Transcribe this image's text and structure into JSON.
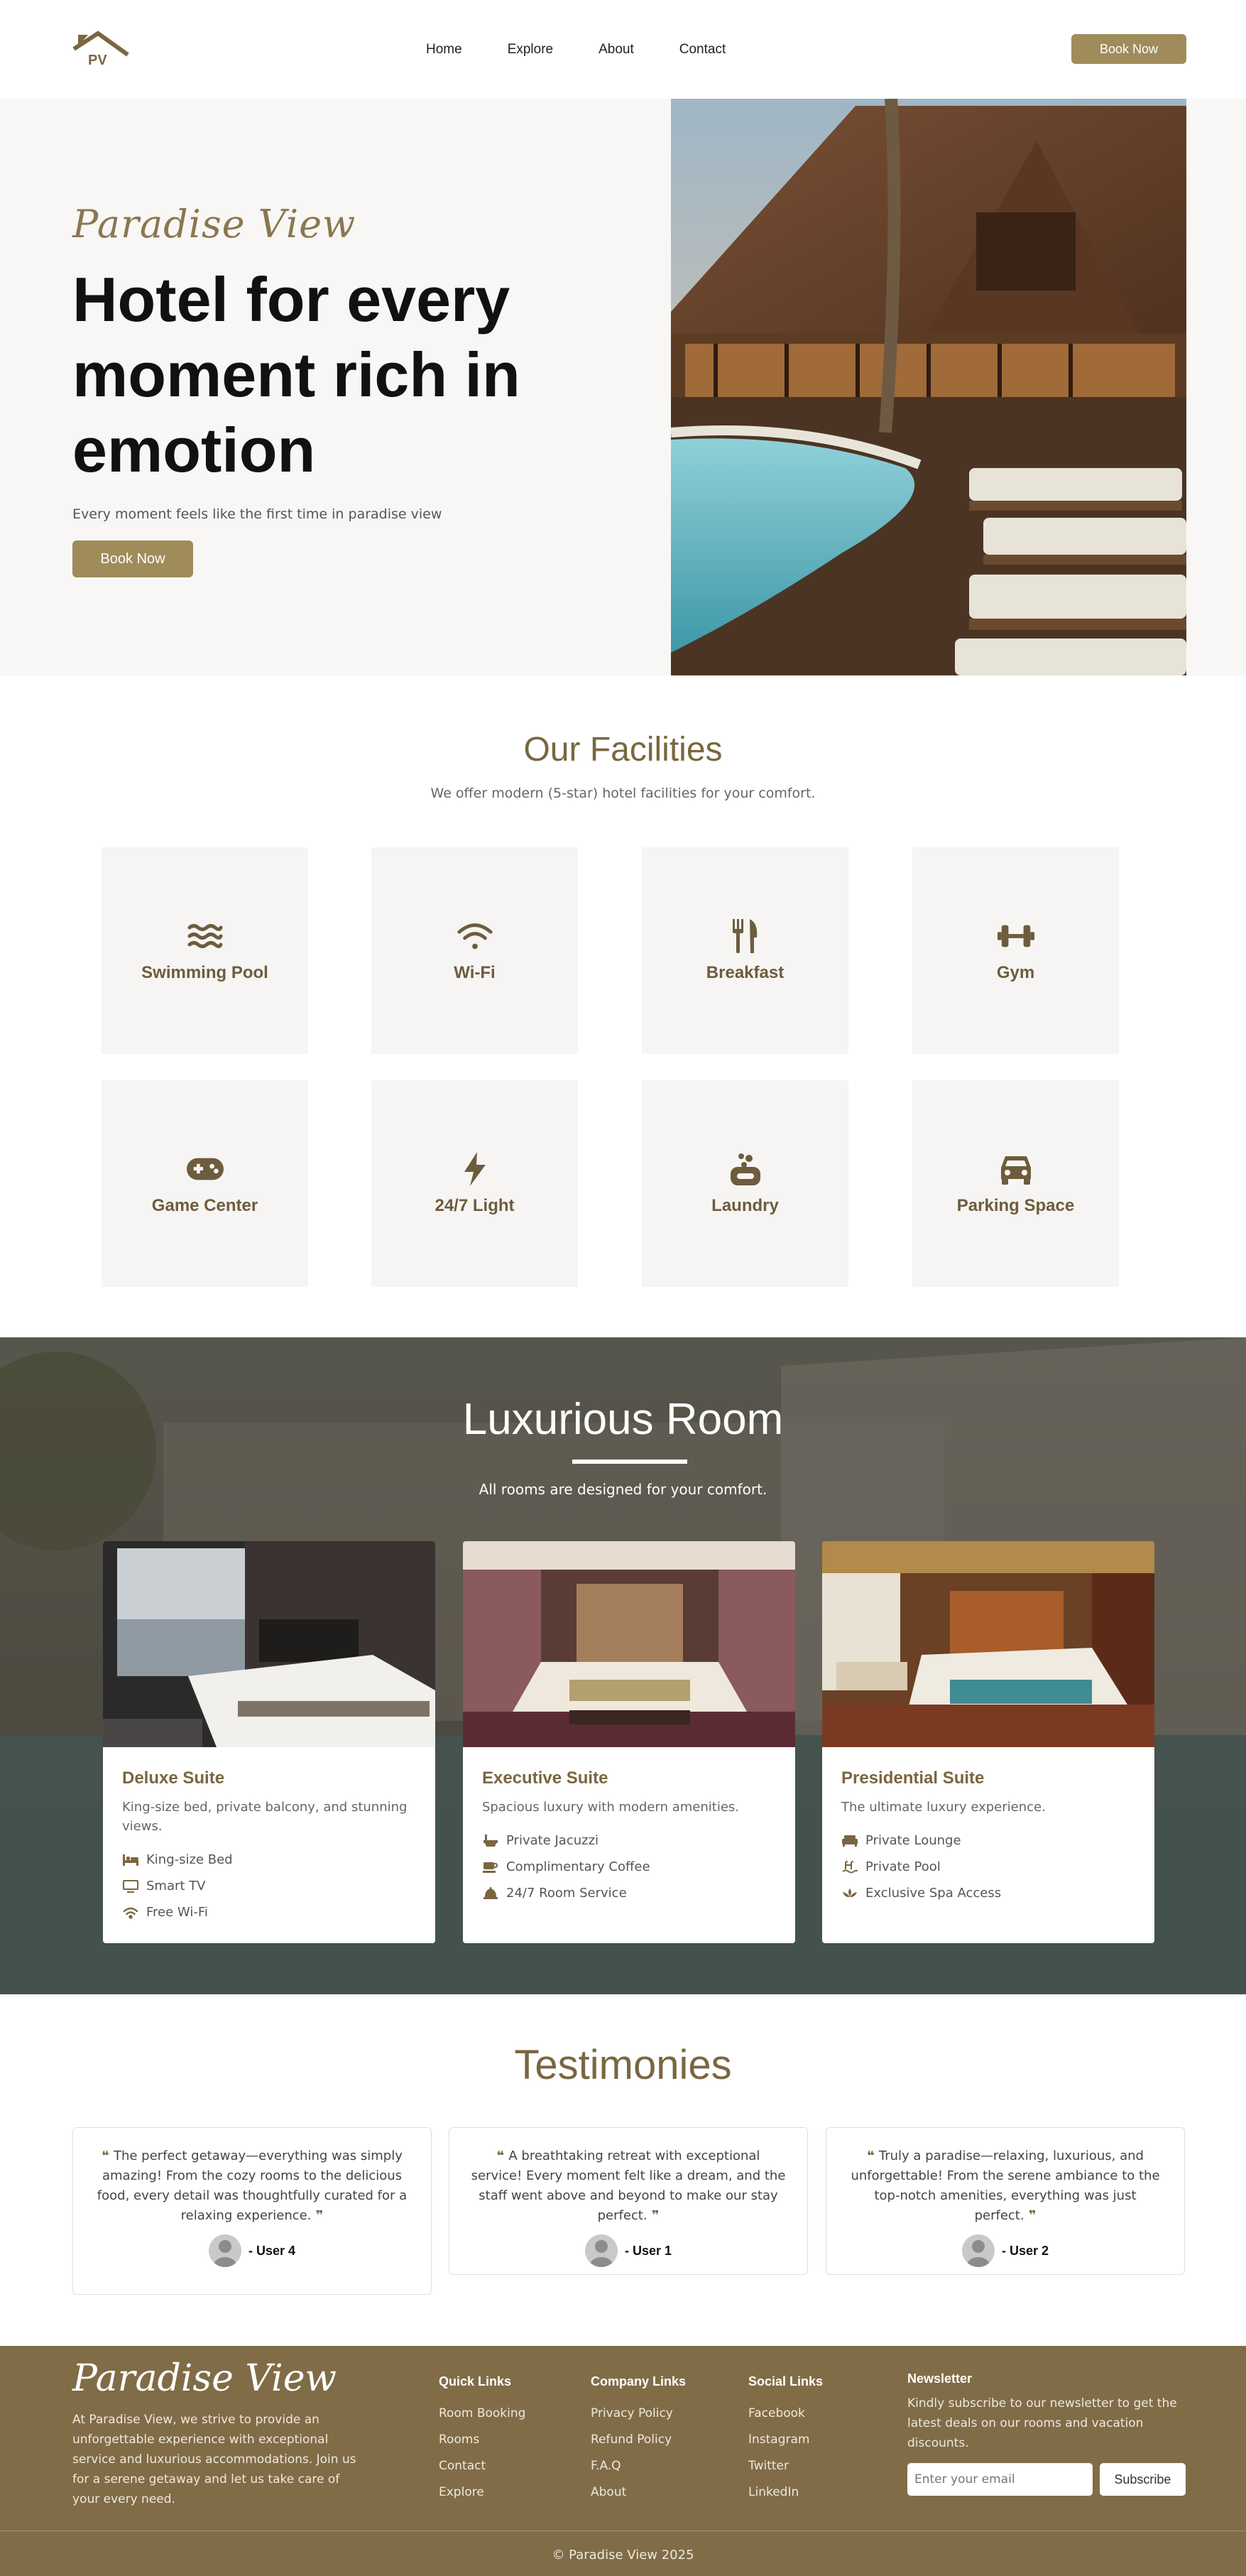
{
  "header": {
    "logo_text": "PV",
    "nav": [
      "Home",
      "Explore",
      "About",
      "Contact"
    ],
    "book_label": "Book Now"
  },
  "hero": {
    "script_title": "Paradise View",
    "headline": "Hotel for every moment rich in emotion",
    "subtitle": "Every moment feels like the first time in paradise view",
    "book_label": "Book Now"
  },
  "facilities": {
    "title": "Our Facilities",
    "subtitle": "We offer modern (5-star) hotel facilities for your comfort.",
    "items": [
      {
        "label": "Swimming Pool",
        "icon": "water-waves-icon"
      },
      {
        "label": "Wi-Fi",
        "icon": "wifi-icon"
      },
      {
        "label": "Breakfast",
        "icon": "utensils-icon"
      },
      {
        "label": "Gym",
        "icon": "dumbbell-icon"
      },
      {
        "label": "Game Center",
        "icon": "gamepad-icon"
      },
      {
        "label": "24/7 Light",
        "icon": "lightning-icon"
      },
      {
        "label": "Laundry",
        "icon": "soap-icon"
      },
      {
        "label": "Parking Space",
        "icon": "car-icon"
      }
    ]
  },
  "rooms": {
    "title": "Luxurious Room",
    "subtitle": "All rooms are designed for your comfort.",
    "items": [
      {
        "title": "Deluxe Suite",
        "desc": "King-size bed, private balcony, and stunning views.",
        "features": [
          "King-size Bed",
          "Smart TV",
          "Free Wi-Fi"
        ]
      },
      {
        "title": "Executive Suite",
        "desc": "Spacious luxury with modern amenities.",
        "features": [
          "Private Jacuzzi",
          "Complimentary Coffee",
          "24/7 Room Service"
        ]
      },
      {
        "title": "Presidential Suite",
        "desc": "The ultimate luxury experience.",
        "features": [
          "Private Lounge",
          "Private Pool",
          "Exclusive Spa Access"
        ]
      }
    ]
  },
  "testimonies": {
    "title": "Testimonies",
    "items": [
      {
        "text": "The perfect getaway—everything was simply amazing! From the cozy rooms to the delicious food, every detail was thoughtfully curated for a relaxing experience.",
        "user": "- User 4"
      },
      {
        "text": "A breathtaking retreat with exceptional service! Every moment felt like a dream, and the staff went above and beyond to make our stay perfect.",
        "user": "- User 1"
      },
      {
        "text": "Truly a paradise—relaxing, luxurious, and unforgettable! From the serene ambiance to the top-notch amenities, everything was just perfect.",
        "user": "- User 2"
      }
    ]
  },
  "footer": {
    "brand": "Paradise View",
    "about": "At Paradise View, we strive to provide an unforgettable experience with exceptional service and luxurious accommodations. Join us for a serene getaway and let us take care of your every need.",
    "quick_links": {
      "title": "Quick Links",
      "links": [
        "Room Booking",
        "Rooms",
        "Contact",
        "Explore"
      ]
    },
    "company_links": {
      "title": "Company Links",
      "links": [
        "Privacy Policy",
        "Refund Policy",
        "F.A.Q",
        "About"
      ]
    },
    "social_links": {
      "title": "Social Links",
      "links": [
        "Facebook",
        "Instagram",
        "Twitter",
        "LinkedIn"
      ]
    },
    "newsletter": {
      "title": "Newsletter",
      "text": "Kindly subscribe to our newsletter to get the latest deals on our rooms and vacation discounts.",
      "placeholder": "Enter your email",
      "button": "Subscribe"
    },
    "copyright": "© Paradise View 2025"
  },
  "colors": {
    "accent": "#a08c5b",
    "brown": "#806c47",
    "heading": "#7a6640"
  }
}
